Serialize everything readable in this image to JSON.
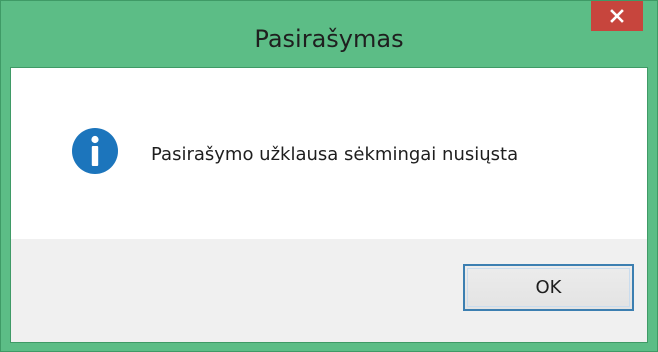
{
  "window": {
    "title": "Pasirašymas"
  },
  "message": {
    "text": "Pasirašymo užklausa sėkmingai nusiųsta",
    "icon": "info-icon"
  },
  "buttons": {
    "ok_label": "OK"
  },
  "colors": {
    "frame": "#5cbd86",
    "close_button": "#c7453d",
    "info_icon": "#1c75bc",
    "button_border": "#3c7fb1"
  }
}
